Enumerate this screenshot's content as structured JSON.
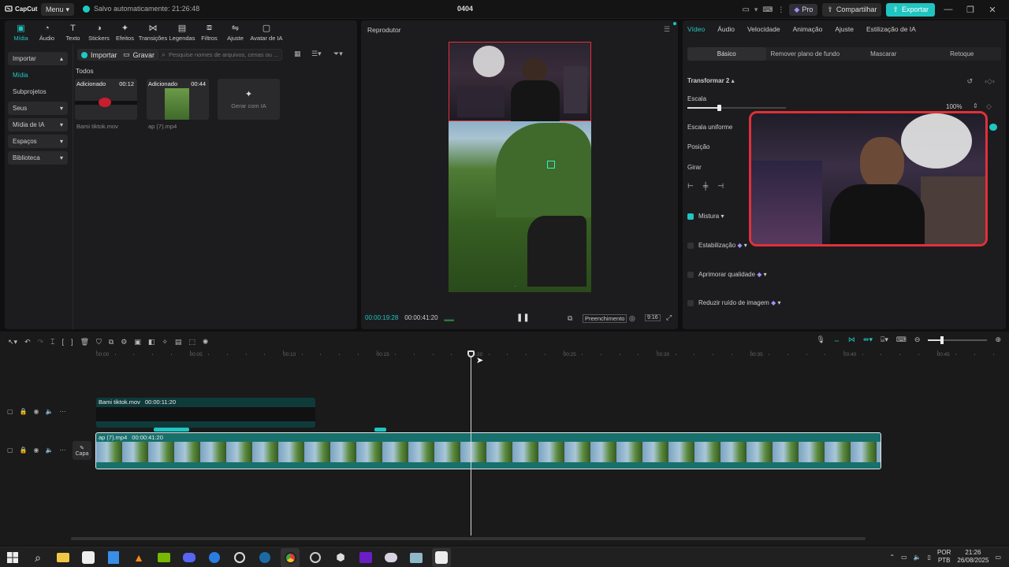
{
  "titlebar": {
    "logo": "CapCut",
    "menu": "Menu",
    "autosave": "Salvo automaticamente: 21:26:48",
    "project_title": "0404",
    "pro": "Pro",
    "share": "Compartilhar",
    "export": "Exportar"
  },
  "toolbar": [
    {
      "label": "Mídia",
      "icon": "media-icon",
      "active": true
    },
    {
      "label": "Áudio",
      "icon": "audio-icon"
    },
    {
      "label": "Texto",
      "icon": "text-icon"
    },
    {
      "label": "Stickers",
      "icon": "sticker-icon"
    },
    {
      "label": "Efeitos",
      "icon": "effects-icon"
    },
    {
      "label": "Transições",
      "icon": "transitions-icon"
    },
    {
      "label": "Legendas",
      "icon": "captions-icon"
    },
    {
      "label": "Filtros",
      "icon": "filters-icon"
    },
    {
      "label": "Ajuste",
      "icon": "adjust-icon"
    },
    {
      "label": "Avatar de IA",
      "icon": "avatar-icon"
    }
  ],
  "sidebar": [
    {
      "label": "Importar",
      "head": true
    },
    {
      "label": "Mídia",
      "selected": true
    },
    {
      "label": "Subprojetos"
    },
    {
      "label": "Seus",
      "head": true
    },
    {
      "label": "Mídia de IA",
      "head": true
    },
    {
      "label": "Espaços",
      "head": true
    },
    {
      "label": "Biblioteca",
      "head": true
    }
  ],
  "media_panel": {
    "import_btn": "Importar",
    "record_btn": "Gravar",
    "search_placeholder": "Pesquise nomes de arquivos, cenas ou ...",
    "section_title": "Todos",
    "items": [
      {
        "tag": "Adicionado",
        "duration": "00:12",
        "name": "Bami tiktok.mov"
      },
      {
        "tag": "Adicionado",
        "duration": "00:44",
        "name": "ap (7).mp4"
      }
    ],
    "ai_generate": "Gerar com IA"
  },
  "player": {
    "title": "Reprodutor",
    "current_time": "00:00:19:28",
    "total_time": "00:00:41:20",
    "fill_label": "Preenchimento",
    "ratio_label": "9:16"
  },
  "right_panel": {
    "tabs": [
      "Vídeo",
      "Áudio",
      "Velocidade",
      "Animação",
      "Ajuste",
      "Estilização de IA"
    ],
    "subtabs": [
      "Básico",
      "Remover plano de fundo",
      "Mascarar",
      "Retoque"
    ],
    "transform": "Transformar 2",
    "scale": "Escala",
    "scale_value": "100%",
    "scale_fraction": 0.32,
    "uniform_scale": "Escala uniforme",
    "position": "Posição",
    "rotate": "Girar",
    "blend": "Mistura",
    "stabilize": "Estabilização",
    "enhance": "Aprimorar qualidade",
    "denoise": "Reduzir ruído de imagem"
  },
  "timeline": {
    "ruler": [
      "00:00",
      "00:05",
      "00:10",
      "00:15",
      "00:20",
      "00:25",
      "00:30",
      "00:35",
      "00:40",
      "00:45"
    ],
    "clip1": {
      "name": "Bami tiktok.mov",
      "duration": "00:00:11:20"
    },
    "clip2": {
      "name": "ap (7).mp4",
      "duration": "00:00:41:20"
    },
    "cover": "Capa"
  },
  "taskbar": {
    "lang": "POR",
    "layout": "PTB",
    "time": "21:26",
    "date": "26/08/2025"
  },
  "colors": {
    "accent": "#20c5c1",
    "pip_border": "#e0303a"
  }
}
